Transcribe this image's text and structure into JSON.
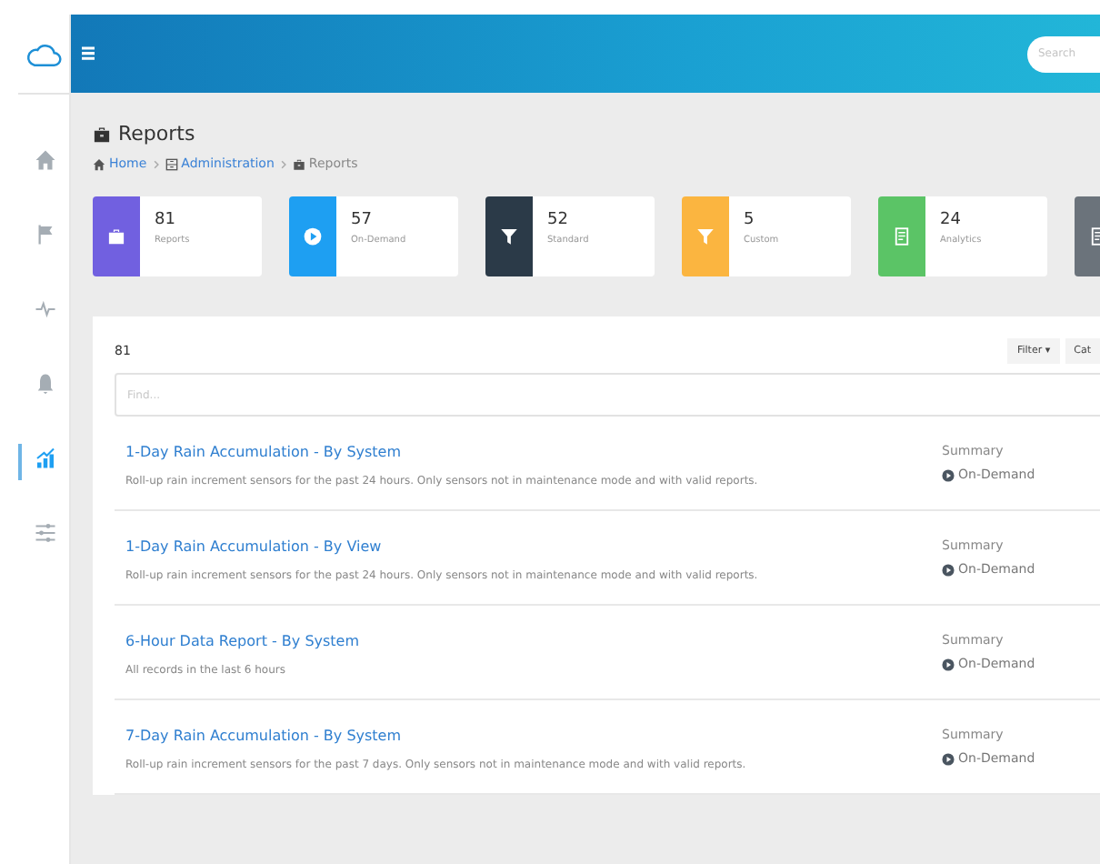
{
  "header": {
    "search": {
      "placeholder": "Search"
    }
  },
  "sidebar": {
    "items": [
      {
        "kind": "home",
        "selected": false
      },
      {
        "kind": "flag",
        "selected": false
      },
      {
        "kind": "pulse",
        "selected": false
      },
      {
        "kind": "bell",
        "selected": false
      },
      {
        "kind": "chart",
        "selected": true
      },
      {
        "kind": "sliders",
        "selected": false
      }
    ]
  },
  "page": {
    "title": "Reports",
    "breadcrumb": [
      {
        "kind": "home",
        "label": "Home",
        "link": true
      },
      {
        "kind": "admin",
        "label": "Administration",
        "link": true
      },
      {
        "kind": "reports",
        "label": "Reports",
        "link": false
      }
    ]
  },
  "stats": [
    {
      "kind": "reports",
      "color": "#7160e0",
      "count": "81",
      "label": "Reports"
    },
    {
      "kind": "ondemand",
      "color": "#1e9ff2",
      "count": "57",
      "label": "On-Demand"
    },
    {
      "kind": "standard",
      "color": "#2b3a48",
      "count": "52",
      "label": "Standard"
    },
    {
      "kind": "custom",
      "color": "#fbb540",
      "count": "5",
      "label": "Custom"
    },
    {
      "kind": "analytics",
      "color": "#5bc466",
      "count": "24",
      "label": "Analytics"
    },
    {
      "kind": "document",
      "color": "#6b737b"
    }
  ],
  "list": {
    "count": "81",
    "buttons": [
      "Filter ▾",
      "Cat"
    ],
    "find": {
      "placeholder": "Find..."
    },
    "reports": [
      {
        "title": "1-Day Rain Accumulation - By System",
        "description": "Roll-up rain increment sensors for the past 24 hours. Only sensors not in maintenance mode and with valid reports.",
        "type": "Summary",
        "mode": "On-Demand"
      },
      {
        "title": "1-Day Rain Accumulation - By View",
        "description": "Roll-up rain increment sensors for the past 24 hours. Only sensors not in maintenance mode and with valid reports.",
        "type": "Summary",
        "mode": "On-Demand"
      },
      {
        "title": "6-Hour Data Report - By System",
        "description": "All records in the last 6 hours",
        "type": "Summary",
        "mode": "On-Demand"
      },
      {
        "title": "7-Day Rain Accumulation - By System",
        "description": "Roll-up rain increment sensors for the past 7 days. Only sensors not in maintenance mode and with valid reports.",
        "type": "Summary",
        "mode": "On-Demand"
      }
    ]
  }
}
